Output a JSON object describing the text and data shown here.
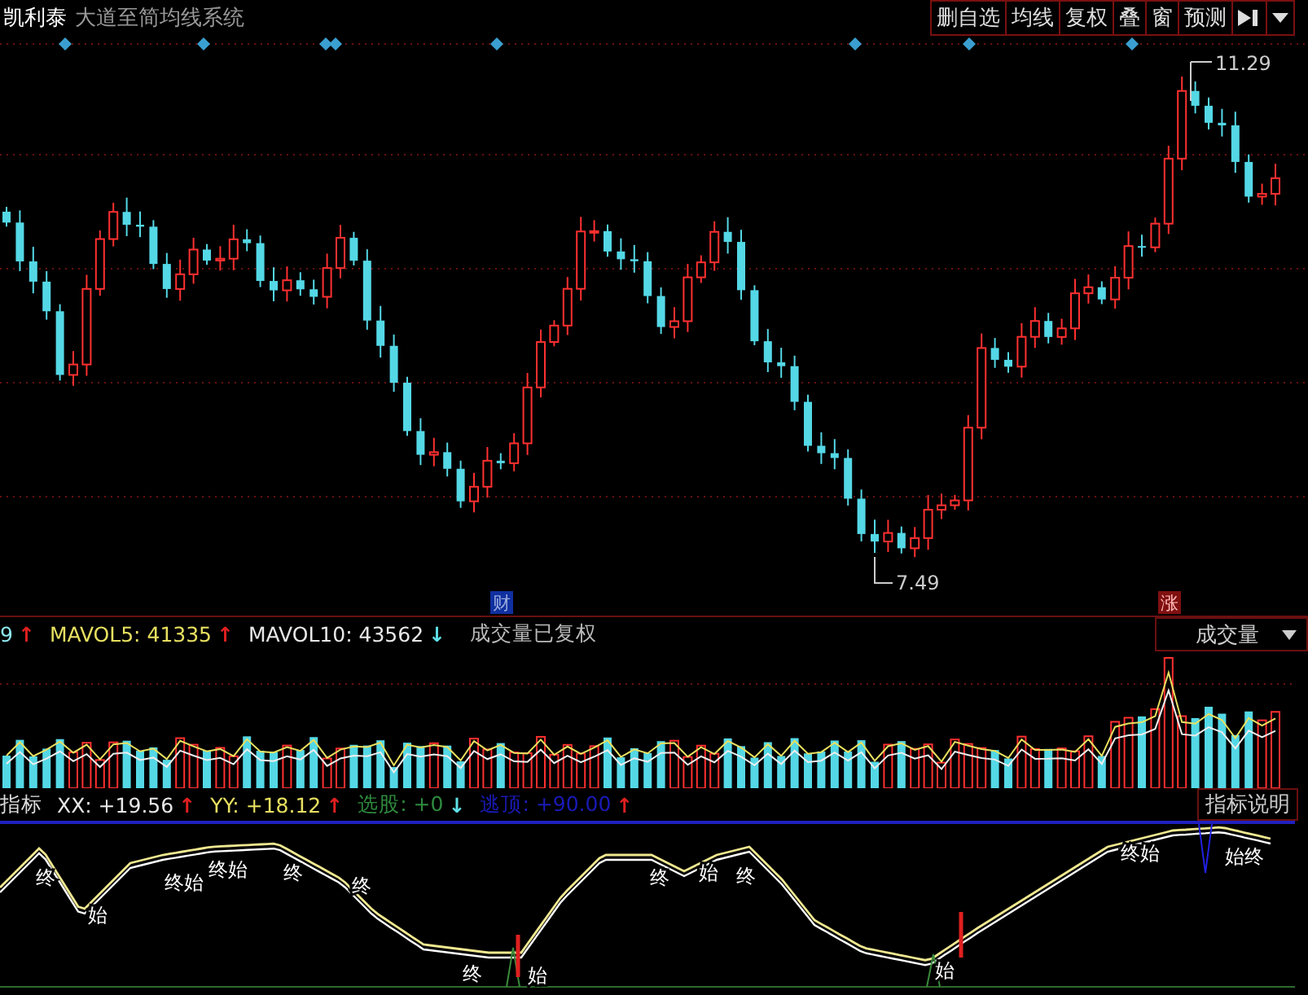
{
  "header": {
    "stock_name": "凯利泰",
    "indicator_name": "大道至简均线系统",
    "buttons": [
      {
        "label": "删自选"
      },
      {
        "label": "均线"
      },
      {
        "label": "复权"
      },
      {
        "label": "叠"
      },
      {
        "label": "窗"
      },
      {
        "label": "预测"
      }
    ]
  },
  "price_chart": {
    "high_label": "11.29",
    "low_label": "7.49",
    "markers": [
      {
        "label": "财",
        "kind": "finance"
      },
      {
        "label": "涨",
        "kind": "limit_up"
      }
    ]
  },
  "volume_legend": {
    "items": [
      {
        "label": "9",
        "arrow": {
          "symbol": "↑",
          "color": "#e02020"
        },
        "color": "#8fe8f0"
      },
      {
        "label": "MAVOL5: 41335",
        "arrow": {
          "symbol": "↑",
          "color": "#e02020"
        },
        "color": "#e8e060"
      },
      {
        "label": "MAVOL10: 43562",
        "arrow": {
          "symbol": "↓",
          "color": "#60e0e8"
        },
        "color": "#e8e8e8"
      }
    ],
    "note": "成交量已复权",
    "selector": "成交量"
  },
  "indicator_legend": {
    "title": "指标",
    "items": [
      {
        "label": "XX: +19.56",
        "arrow": {
          "symbol": "↑",
          "color": "#e02020"
        },
        "color": "#e8e8e8"
      },
      {
        "label": "YY: +18.12",
        "arrow": {
          "symbol": "↑",
          "color": "#e02020"
        },
        "color": "#e8e060"
      },
      {
        "label": "选股: +0",
        "arrow": {
          "symbol": "↓",
          "color": "#60e0e8"
        },
        "color": "#2e8b3e"
      },
      {
        "label": "逃顶: +90.00",
        "arrow": {
          "symbol": "↑",
          "color": "#e02020"
        },
        "color": "#1a1ab8"
      }
    ],
    "help_button": "指标说明"
  },
  "indicator_chart": {
    "signals": [
      {
        "label": "终"
      },
      {
        "label": "始"
      },
      {
        "label": "终始"
      },
      {
        "label": "终始"
      },
      {
        "label": "终"
      },
      {
        "label": "终"
      },
      {
        "label": "终"
      },
      {
        "label": "始"
      },
      {
        "label": "终"
      },
      {
        "label": "始"
      },
      {
        "label": "终"
      },
      {
        "label": "始"
      },
      {
        "label": "终始"
      },
      {
        "label": "始终"
      }
    ]
  }
}
